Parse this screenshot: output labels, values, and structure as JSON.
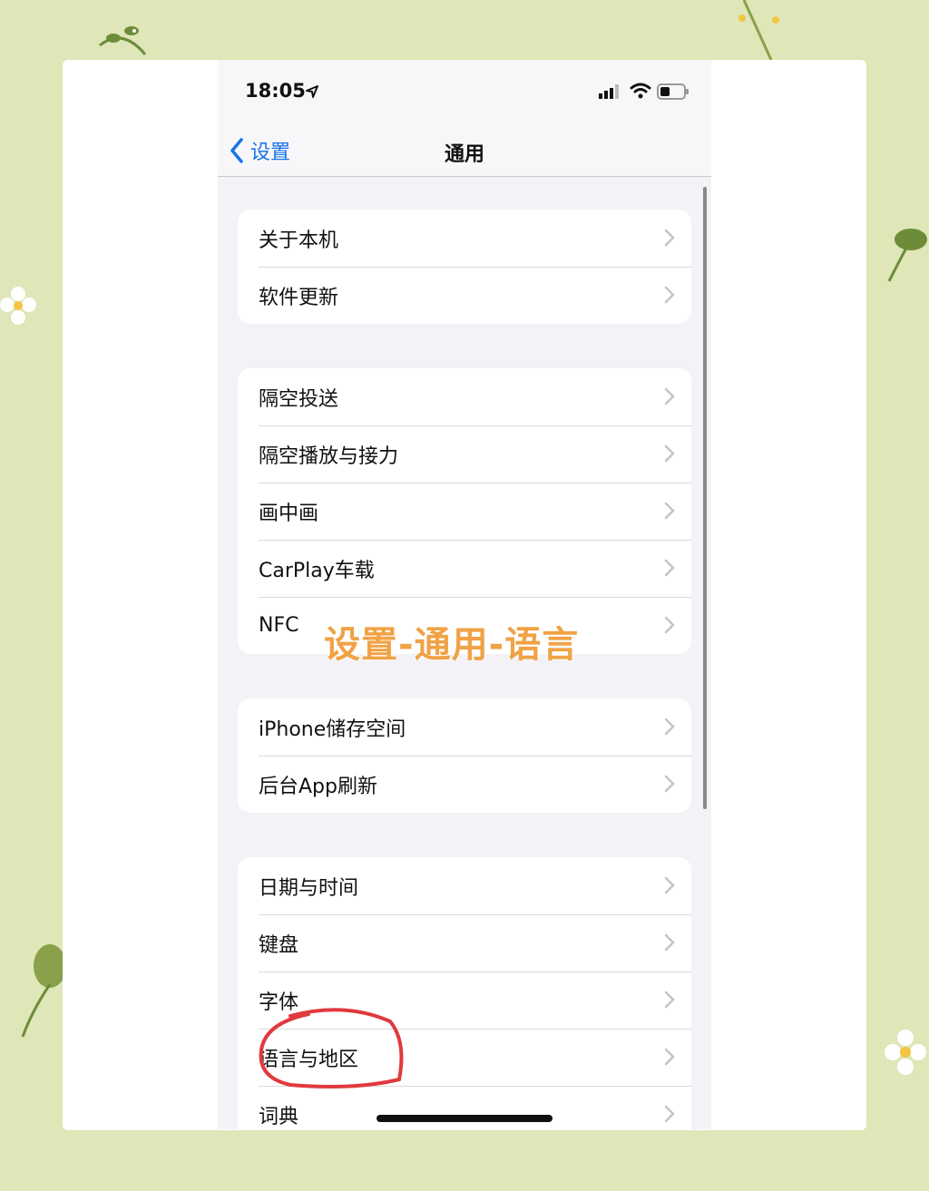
{
  "status_bar": {
    "time": "18:05"
  },
  "nav": {
    "back_label": "设置",
    "title": "通用"
  },
  "groups": [
    {
      "items": [
        {
          "label": "关于本机"
        },
        {
          "label": "软件更新"
        }
      ]
    },
    {
      "items": [
        {
          "label": "隔空投送"
        },
        {
          "label": "隔空播放与接力"
        },
        {
          "label": "画中画"
        },
        {
          "label": "CarPlay车载"
        },
        {
          "label": "NFC"
        }
      ]
    },
    {
      "items": [
        {
          "label": "iPhone储存空间"
        },
        {
          "label": "后台App刷新"
        }
      ]
    },
    {
      "items": [
        {
          "label": "日期与时间"
        },
        {
          "label": "键盘"
        },
        {
          "label": "字体"
        },
        {
          "label": "语言与地区"
        },
        {
          "label": "词典"
        }
      ]
    }
  ],
  "overlay": {
    "caption": "设置-通用-语言"
  },
  "colors": {
    "accent": "#1a73e8",
    "caption": "#f0a245",
    "circle": "#e0393e",
    "backdrop": "#dfe6b8"
  }
}
